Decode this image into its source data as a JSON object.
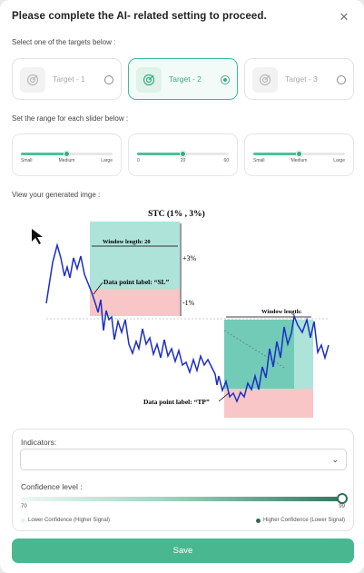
{
  "dialog": {
    "title": "Please complete the AI- related setting to proceed.",
    "close_icon": "close-icon"
  },
  "targets": {
    "label": "Select one of the targets below :",
    "items": [
      {
        "label": "Target - 1",
        "selected": false,
        "icon": "target-icon"
      },
      {
        "label": "Target - 2",
        "selected": true,
        "icon": "target-icon"
      },
      {
        "label": "Target - 3",
        "selected": false,
        "icon": "target-icon"
      }
    ]
  },
  "sliders": {
    "label": "Set the range for each slider below :",
    "items": [
      {
        "ticks": [
          "Small",
          "Medium",
          "Large"
        ],
        "value_fraction": 0.5
      },
      {
        "ticks": [
          "0",
          "20",
          "60"
        ],
        "value_fraction": 0.5
      },
      {
        "ticks": [
          "Small",
          "Medium",
          "Large"
        ],
        "value_fraction": 0.5
      }
    ]
  },
  "image_section": {
    "label": "View your generated imge :",
    "figure_title": "STC (1% , 3%)",
    "window_label_1": "Window length: 20",
    "plus_label": "+3%",
    "sl_label": "Data point label: “SL”",
    "minus_label": "-1%",
    "window_label_2": "Window length:",
    "tp_label": "Data point label: “TP”",
    "colors": {
      "take_profit": "#aee3da",
      "stop_loss": "#f8c6c6",
      "line": "#1d2fc4"
    }
  },
  "indicators": {
    "label": "Indicators:",
    "value": ""
  },
  "confidence": {
    "label": "Confidence level :",
    "min": "70",
    "max": "99",
    "value": 99,
    "low_legend": "Lower Confidence (Higher Signal)",
    "high_legend": "Higher Confidence (Lower Signal)",
    "colors": {
      "low": "#e3f4ec",
      "high": "#2e6b57"
    }
  },
  "save_label": "Save",
  "accent": "#49b890"
}
